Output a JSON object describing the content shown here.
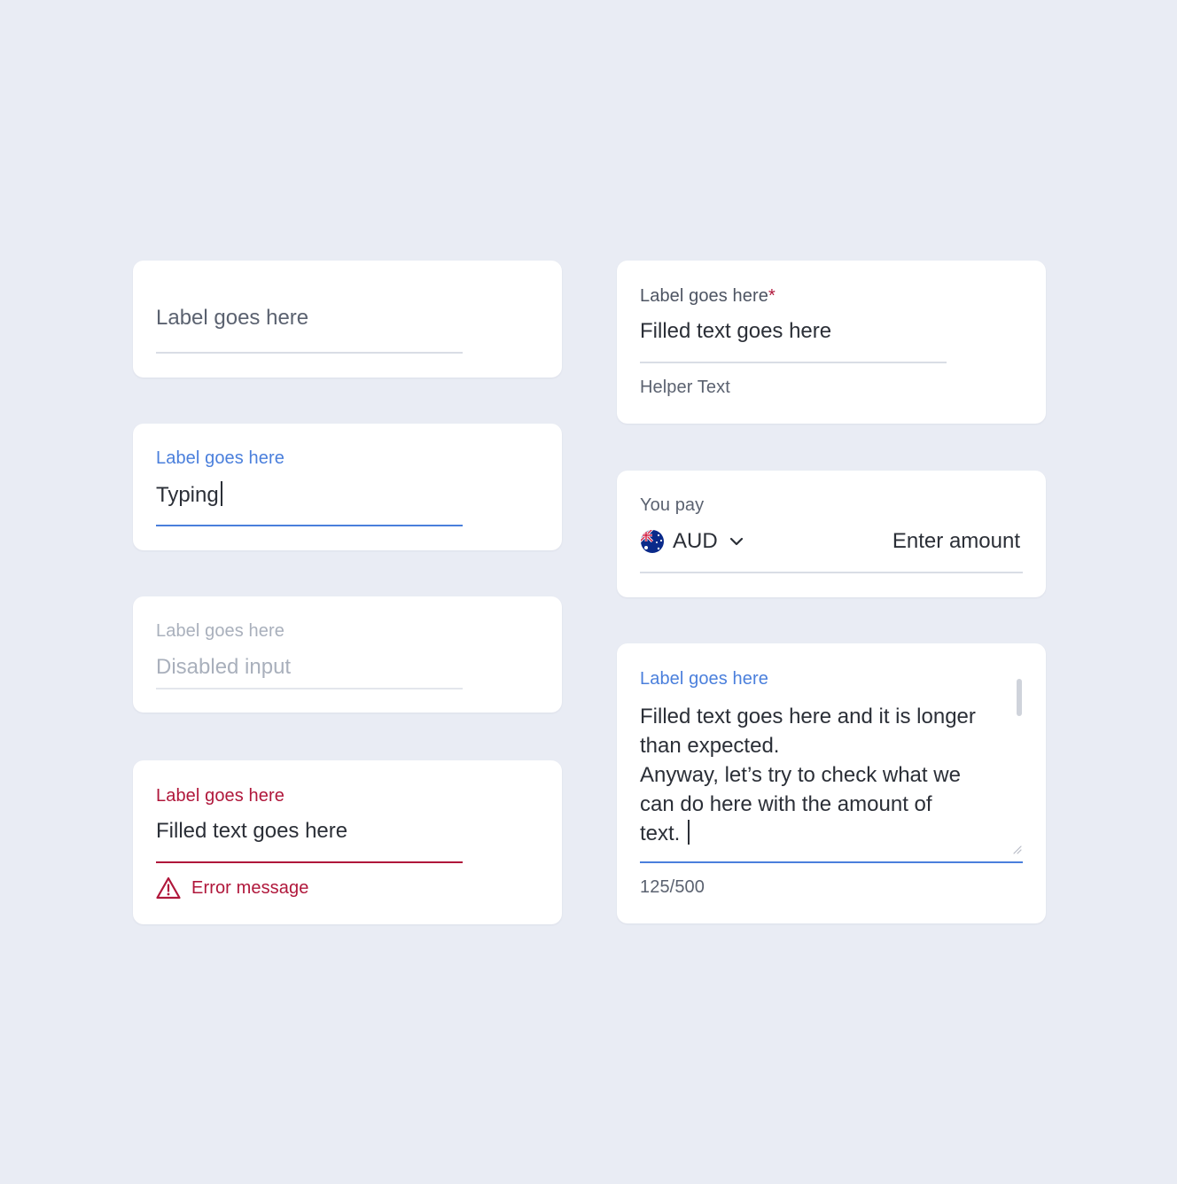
{
  "colors": {
    "background": "#e9ecf4",
    "card": "#ffffff",
    "text": "#2b2f37",
    "muted": "#5b6270",
    "accent": "#4a7fdc",
    "error": "#b0173b",
    "disabled": "#a9b0bc"
  },
  "fields": {
    "empty": {
      "label": "Label goes here"
    },
    "focused": {
      "label": "Label goes here",
      "value": "Typing"
    },
    "disabled": {
      "label": "Label goes here",
      "value": "Disabled input"
    },
    "error": {
      "label": "Label goes here",
      "value": "Filled text goes here",
      "message": "Error message",
      "icon": "warning-triangle-icon"
    },
    "required": {
      "label": "Label goes here",
      "required_mark": "*",
      "value": "Filled text goes here",
      "helper": "Helper Text"
    },
    "currency": {
      "label": "You pay",
      "currency": "AUD",
      "flag": "australia-flag-icon",
      "amount_placeholder": "Enter amount"
    },
    "textarea": {
      "label": "Label goes here",
      "value": "Filled text goes here and it is longer\nthan expected.\nAnyway, let’s try to check what we\ncan do here with the amount of\ntext. ",
      "counter": "125/500"
    }
  }
}
